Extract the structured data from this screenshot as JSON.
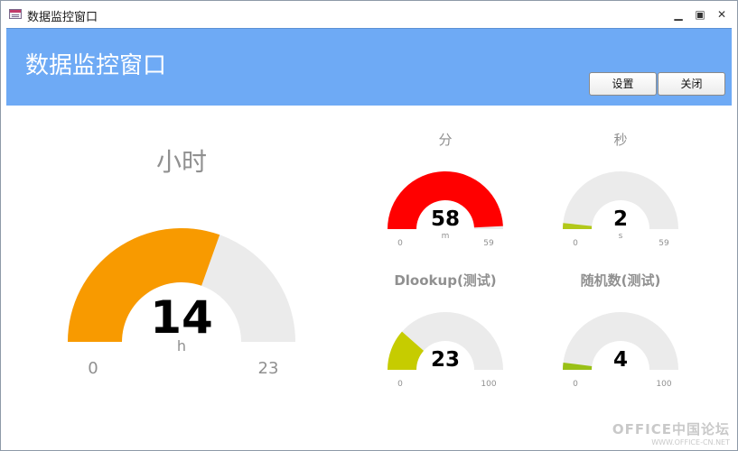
{
  "window": {
    "title": "数据监控窗口",
    "min_label": "▁",
    "max_label": "▣",
    "close_label": "✕"
  },
  "header": {
    "title": "数据监控窗口",
    "settings_label": "设置",
    "close_label": "关闭",
    "background": "#6eaaf5"
  },
  "colors": {
    "track": "#ebebeb",
    "title_text": "#909090",
    "tick_text": "#909090",
    "value_text": "#000000"
  },
  "gauges": [
    {
      "key": "hour",
      "title": "小时",
      "value": 14,
      "display": "14",
      "unit": "h",
      "min": 0,
      "max": 23,
      "min_label": "0",
      "max_label": "23",
      "color": "#f89a00"
    },
    {
      "key": "minute",
      "title": "分",
      "value": 58,
      "display": "58",
      "unit": "m",
      "min": 0,
      "max": 59,
      "min_label": "0",
      "max_label": "59",
      "color": "#ff0000"
    },
    {
      "key": "second",
      "title": "秒",
      "value": 2,
      "display": "2",
      "unit": "s",
      "min": 0,
      "max": 59,
      "min_label": "0",
      "max_label": "59",
      "color": "#b2c81a"
    },
    {
      "key": "dlookup",
      "title": "Dlookup(测试)",
      "value": 23,
      "display": "23",
      "unit": "",
      "min": 0,
      "max": 100,
      "min_label": "0",
      "max_label": "100",
      "color": "#c6cc00"
    },
    {
      "key": "random",
      "title": "随机数(测试)",
      "value": 4,
      "display": "4",
      "unit": "",
      "min": 0,
      "max": 100,
      "min_label": "0",
      "max_label": "100",
      "color": "#99c016"
    }
  ],
  "watermark": {
    "line1": "OFFICE中国论坛",
    "line2": "WWW.OFFICE-CN.NET"
  }
}
